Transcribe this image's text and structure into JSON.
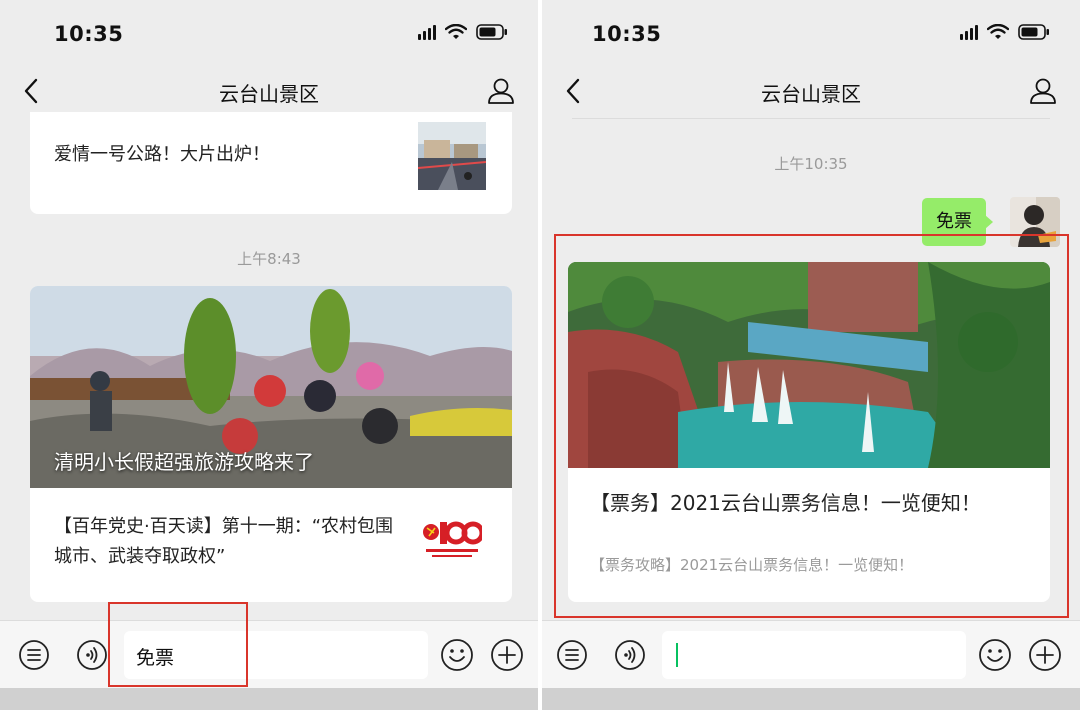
{
  "left_screen": {
    "status_time": "10:35",
    "nav_title": "云台山景区",
    "top_card_title": "爱情一号公路！大片出炉！",
    "timestamp": "上午8:43",
    "article": {
      "overlay_caption": "清明小长假超强旅游攻略来了",
      "title": "【百年党史·百天读】第十一期：“农村包围城市、武装夺取政权”"
    },
    "input_value": "免票"
  },
  "right_screen": {
    "status_time": "10:35",
    "nav_title": "云台山景区",
    "timestamp": "上午10:35",
    "sent_message": "免票",
    "reply_card": {
      "title": "【票务】2021云台山票务信息！一览便知！",
      "subtitle": "【票务攻略】2021云台山票务信息！一览便知！"
    },
    "input_value": ""
  },
  "colors": {
    "highlight": "#d9352b",
    "bubble": "#95ec69",
    "accent": "#07c160",
    "chat_bg": "#ededed"
  },
  "icons": [
    "back-chevron-icon",
    "profile-icon",
    "signal-icon",
    "wifi-icon",
    "battery-icon",
    "list-icon",
    "voice-icon",
    "emoji-icon",
    "plus-icon"
  ]
}
